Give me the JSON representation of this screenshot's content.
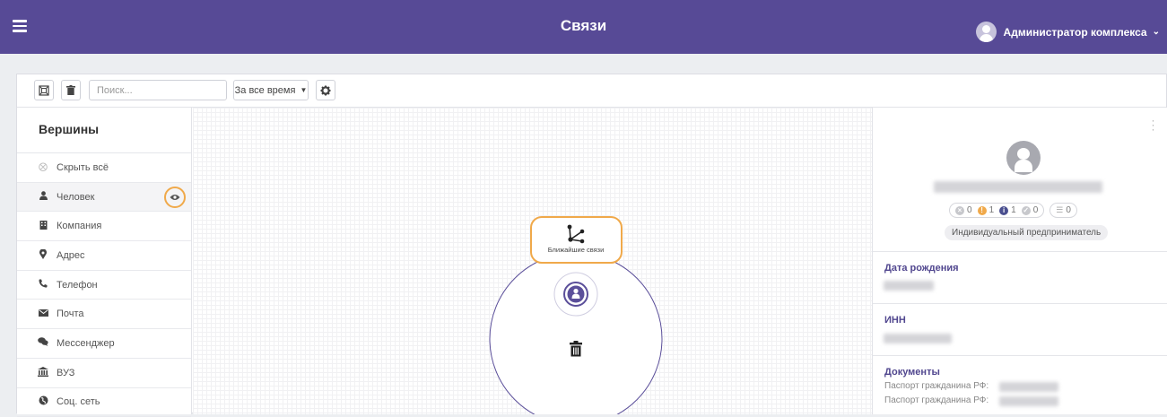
{
  "header": {
    "title": "Связи",
    "user_name": "Администратор комплекса"
  },
  "toolbar": {
    "search_placeholder": "Поиск...",
    "period_label": "За все время"
  },
  "sidebar": {
    "title": "Вершины",
    "items": [
      {
        "label": "Скрыть всё",
        "icon": "close-circle-icon"
      },
      {
        "label": "Человек",
        "icon": "person-icon",
        "active": true
      },
      {
        "label": "Компания",
        "icon": "building-icon"
      },
      {
        "label": "Адрес",
        "icon": "map-marker-icon"
      },
      {
        "label": "Телефон",
        "icon": "phone-icon"
      },
      {
        "label": "Почта",
        "icon": "envelope-icon"
      },
      {
        "label": "Мессенджер",
        "icon": "chat-icon"
      },
      {
        "label": "ВУЗ",
        "icon": "university-icon"
      },
      {
        "label": "Соц. сеть",
        "icon": "globe-icon"
      }
    ]
  },
  "graph": {
    "menu_action_label": "Ближайшие связи"
  },
  "details": {
    "counters": {
      "rejected": "0",
      "warning": "1",
      "info": "1",
      "ok": "0",
      "list": "0"
    },
    "type_badge": "Индивидуальный предприниматель",
    "fields": {
      "birth_label": "Дата рождения",
      "inn_label": "ИНН",
      "documents_label": "Документы",
      "doc1": "Паспорт гражданина РФ:",
      "doc2": "Паспорт гражданина РФ:"
    }
  },
  "colors": {
    "header": "#574a96",
    "accent_orange": "#f0a94a",
    "label_purple": "#51478f"
  }
}
